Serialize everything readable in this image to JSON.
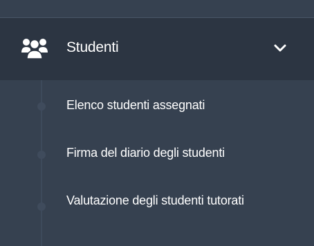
{
  "menu": {
    "section_label": "Studenti",
    "section_icon": "users-icon",
    "expand_icon": "chevron-down-icon",
    "items": [
      {
        "label": "Elenco studenti assegnati"
      },
      {
        "label": "Firma del diario degli studenti"
      },
      {
        "label": "Valutazione degli studenti tutorati"
      }
    ]
  },
  "colors": {
    "sidebar_bg": "#364150",
    "header_bg": "#2c3542",
    "text": "#ffffff"
  }
}
